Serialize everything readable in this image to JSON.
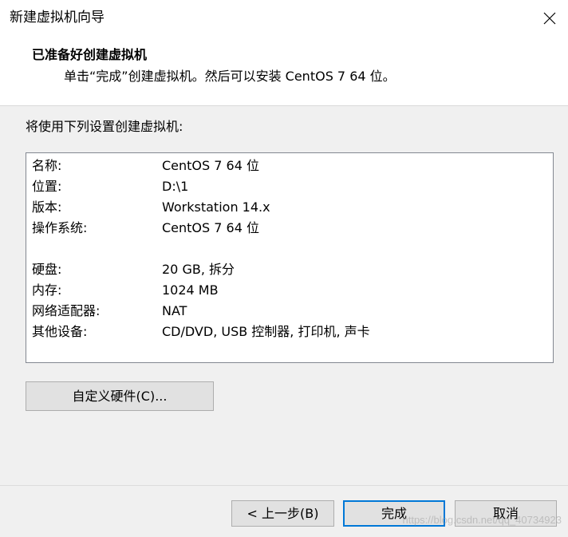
{
  "window": {
    "title": "新建虚拟机向导",
    "close_icon": "close-icon"
  },
  "header": {
    "title": "已准备好创建虚拟机",
    "subtitle": "单击“完成”创建虚拟机。然后可以安装 CentOS 7 64 位。"
  },
  "intro": "将使用下列设置创建虚拟机:",
  "summary": [
    {
      "label": "名称:",
      "value": "CentOS 7 64 位"
    },
    {
      "label": "位置:",
      "value": "D:\\1"
    },
    {
      "label": "版本:",
      "value": "Workstation 14.x"
    },
    {
      "label": "操作系统:",
      "value": "CentOS 7 64 位"
    },
    {
      "label": "硬盘:",
      "value": "20 GB, 拆分"
    },
    {
      "label": "内存:",
      "value": "1024 MB"
    },
    {
      "label": "网络适配器:",
      "value": "NAT"
    },
    {
      "label": "其他设备:",
      "value": "CD/DVD, USB 控制器, 打印机, 声卡"
    }
  ],
  "buttons": {
    "customize": "自定义硬件(C)...",
    "back": "< 上一步(B)",
    "finish": "完成",
    "cancel": "取消"
  },
  "watermark": "https://blog.csdn.net/qq_40734923",
  "colors": {
    "focus_border": "#0078d7",
    "button_bg": "#e1e1e1",
    "dialog_bg": "#f0f0f0"
  }
}
